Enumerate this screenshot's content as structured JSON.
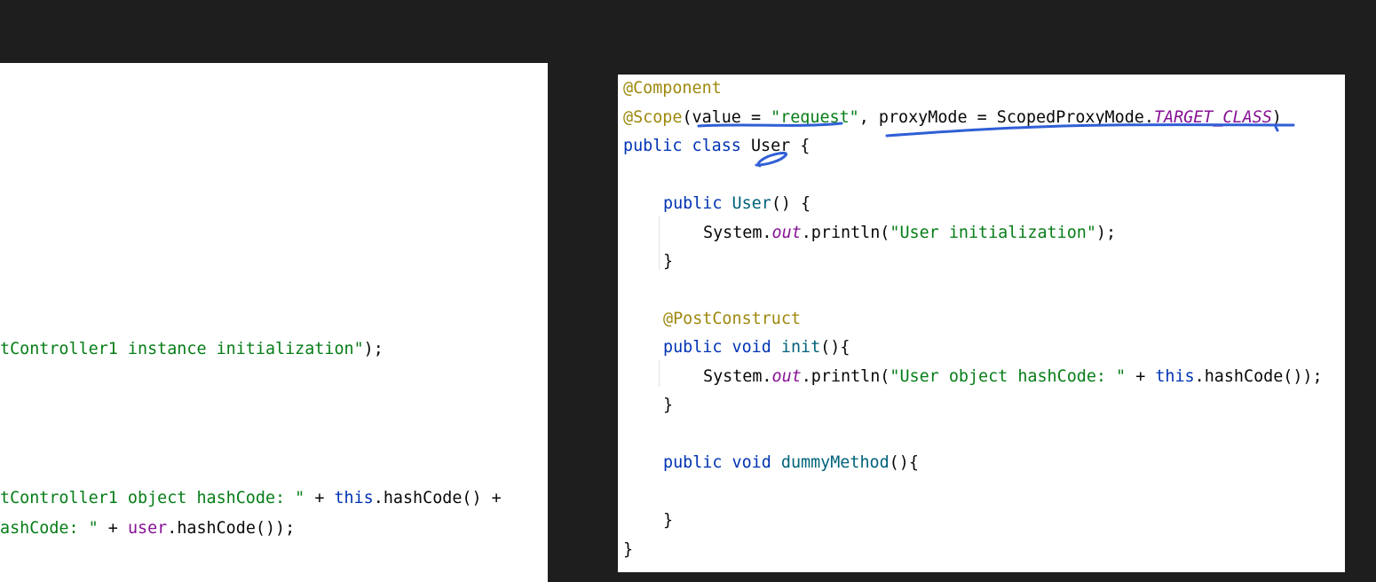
{
  "left_panel": {
    "lines": [
      {
        "segments": [
          {
            "text": ")",
            "style": "plain"
          }
        ]
      },
      {
        "segments": [
          {
            "text": "tController1 instance initialization\"",
            "style": "str"
          },
          {
            "text": ");",
            "style": "plain"
          }
        ]
      },
      {
        "segments": [
          {
            "text": "tController1 object hashCode: \"",
            "style": "str"
          },
          {
            "text": " + ",
            "style": "plain"
          },
          {
            "text": "this",
            "style": "kw"
          },
          {
            "text": ".hashCode() +",
            "style": "plain"
          }
        ]
      },
      {
        "segments": [
          {
            "text": "ashCode: \"",
            "style": "str"
          },
          {
            "text": " + ",
            "style": "plain"
          },
          {
            "text": "user",
            "style": "field"
          },
          {
            "text": ".hashCode());",
            "style": "plain"
          }
        ]
      }
    ]
  },
  "right_panel": {
    "lines": [
      {
        "segments": [
          {
            "text": "@Component",
            "style": "ann"
          }
        ]
      },
      {
        "segments": [
          {
            "text": "@Scope",
            "style": "ann"
          },
          {
            "text": "(value = ",
            "style": "plain"
          },
          {
            "text": "\"request\"",
            "style": "str"
          },
          {
            "text": ", proxyMode = ScopedProxyMode.",
            "style": "plain"
          },
          {
            "text": "TARGET_CLASS",
            "style": "sfield"
          },
          {
            "text": ")",
            "style": "plain"
          }
        ]
      },
      {
        "segments": [
          {
            "text": "public class ",
            "style": "kw"
          },
          {
            "text": "User {",
            "style": "plain"
          }
        ]
      },
      {
        "segments": [
          {
            "text": "public ",
            "style": "kw"
          },
          {
            "text": "User",
            "style": "mdecl"
          },
          {
            "text": "() {",
            "style": "plain"
          }
        ]
      },
      {
        "segments": [
          {
            "text": "System.",
            "style": "plain"
          },
          {
            "text": "out",
            "style": "sfield"
          },
          {
            "text": ".println(",
            "style": "plain"
          },
          {
            "text": "\"User initialization\"",
            "style": "str"
          },
          {
            "text": ");",
            "style": "plain"
          }
        ]
      },
      {
        "segments": [
          {
            "text": "}",
            "style": "plain"
          }
        ]
      },
      {
        "segments": [
          {
            "text": "@PostConstruct",
            "style": "ann"
          }
        ]
      },
      {
        "segments": [
          {
            "text": "public void ",
            "style": "kw"
          },
          {
            "text": "init",
            "style": "mdecl"
          },
          {
            "text": "(){",
            "style": "plain"
          }
        ]
      },
      {
        "segments": [
          {
            "text": "System.",
            "style": "plain"
          },
          {
            "text": "out",
            "style": "sfield"
          },
          {
            "text": ".println(",
            "style": "plain"
          },
          {
            "text": "\"User object hashCode: \"",
            "style": "str"
          },
          {
            "text": " + ",
            "style": "plain"
          },
          {
            "text": "this",
            "style": "kw"
          },
          {
            "text": ".hashCode());",
            "style": "plain"
          }
        ]
      },
      {
        "segments": [
          {
            "text": "}",
            "style": "plain"
          }
        ]
      },
      {
        "segments": [
          {
            "text": "public void ",
            "style": "kw"
          },
          {
            "text": "dummyMethod",
            "style": "mdecl"
          },
          {
            "text": "(){",
            "style": "plain"
          }
        ]
      },
      {
        "segments": [
          {
            "text": "}",
            "style": "plain"
          }
        ]
      },
      {
        "segments": [
          {
            "text": "}",
            "style": "plain"
          }
        ]
      }
    ]
  },
  "annotation": {
    "color": "#2f5fd6",
    "meaning": "handwritten underlines"
  }
}
